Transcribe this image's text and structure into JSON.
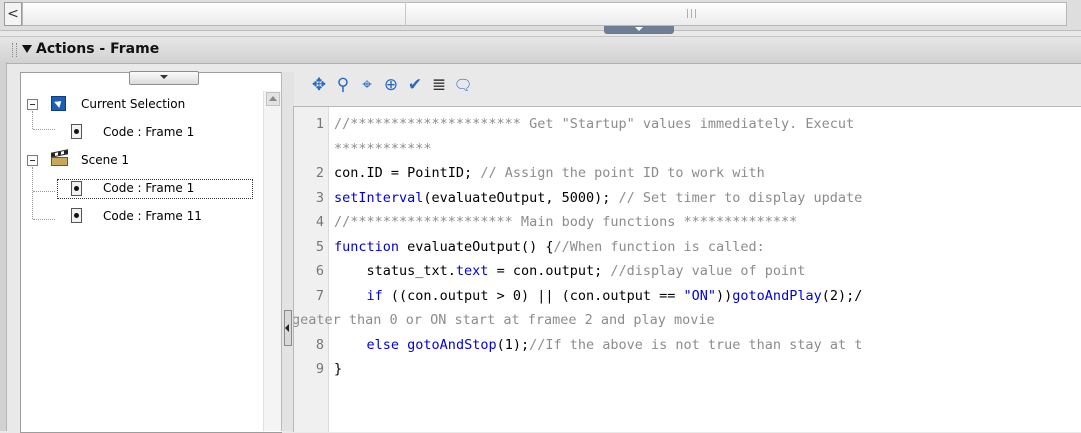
{
  "scroll": {
    "left_arrow": "<",
    "grip": "|||"
  },
  "panel": {
    "title": "Actions - Frame"
  },
  "tree": {
    "current_selection": {
      "label": "Current Selection",
      "child": "Code : Frame 1"
    },
    "scene": {
      "label": "Scene 1",
      "children": [
        "Code : Frame 1",
        "Code : Frame 11"
      ]
    }
  },
  "toolbar": {
    "icons": [
      "add-statement-icon",
      "find-icon",
      "insert-target-path-icon",
      "debug-options-icon",
      "check-syntax-icon",
      "auto-format-icon",
      "show-code-hint-icon"
    ],
    "glyphs": [
      "✥",
      "⚲",
      "⌖",
      "⊕",
      "✔",
      "≣",
      "🗨"
    ]
  },
  "code": {
    "lines": [
      {
        "n": "1",
        "parts": [
          {
            "t": "//********************* Get \"Startup\" values immediately. Execut",
            "c": "cmt"
          }
        ]
      },
      {
        "n": "",
        "parts": [
          {
            "t": "************",
            "c": "cmt"
          }
        ]
      },
      {
        "n": "2",
        "parts": [
          {
            "t": "con.ID = PointID; ",
            "c": ""
          },
          {
            "t": "// Assign the point ID to work with",
            "c": "cmt"
          }
        ]
      },
      {
        "n": "3",
        "parts": [
          {
            "t": "setInterval",
            "c": "kw"
          },
          {
            "t": "(evaluateOutput, 5000); ",
            "c": ""
          },
          {
            "t": "// Set timer to display update",
            "c": "cmt"
          }
        ]
      },
      {
        "n": "4",
        "parts": [
          {
            "t": "//******************** Main body functions **************",
            "c": "cmt"
          }
        ]
      },
      {
        "n": "5",
        "parts": [
          {
            "t": "function",
            "c": "kw"
          },
          {
            "t": " evaluateOutput() {",
            "c": ""
          },
          {
            "t": "//When function is called:",
            "c": "cmt"
          }
        ]
      },
      {
        "n": "6",
        "parts": [
          {
            "t": "    status_txt.",
            "c": ""
          },
          {
            "t": "text",
            "c": "kw"
          },
          {
            "t": " = con.output; ",
            "c": ""
          },
          {
            "t": "//display value of point",
            "c": "cmt"
          }
        ]
      },
      {
        "n": "7",
        "parts": [
          {
            "t": "    ",
            "c": ""
          },
          {
            "t": "if",
            "c": "kw"
          },
          {
            "t": " ((con.output > 0) || (con.output == ",
            "c": ""
          },
          {
            "t": "\"ON\"",
            "c": "str"
          },
          {
            "t": "))",
            "c": ""
          },
          {
            "t": "gotoAndPlay",
            "c": "kw"
          },
          {
            "t": "(2);/",
            "c": ""
          }
        ]
      },
      {
        "n": "",
        "parts": [
          {
            "t": "geater than 0 or ON start at framee 2 and play movie",
            "c": "cmt"
          }
        ],
        "wrap": true
      },
      {
        "n": "8",
        "parts": [
          {
            "t": "    ",
            "c": ""
          },
          {
            "t": "else",
            "c": "kw"
          },
          {
            "t": " ",
            "c": ""
          },
          {
            "t": "gotoAndStop",
            "c": "kw"
          },
          {
            "t": "(1);",
            "c": ""
          },
          {
            "t": "//If the above is not true than stay at t",
            "c": "cmt"
          }
        ]
      },
      {
        "n": "9",
        "parts": [
          {
            "t": "}",
            "c": ""
          }
        ]
      }
    ]
  }
}
